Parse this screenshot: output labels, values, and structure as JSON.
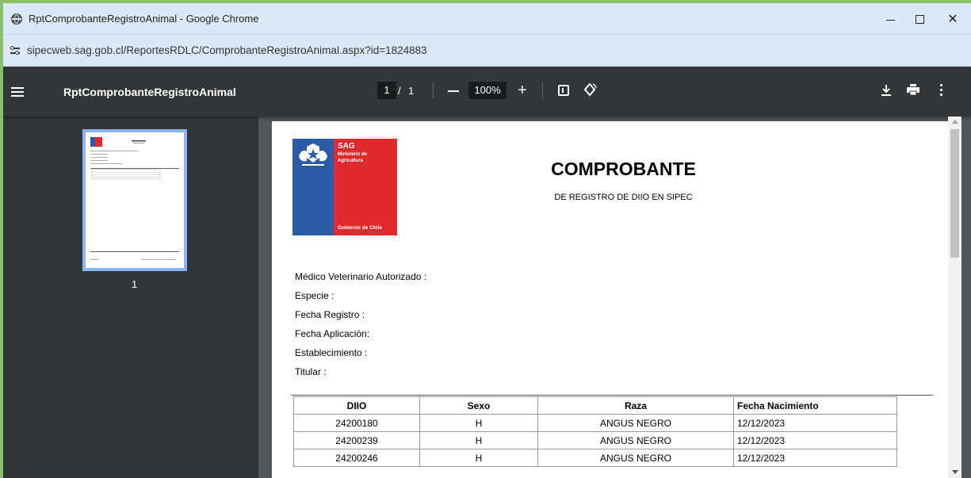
{
  "window": {
    "title": "RptComprobanteRegistroAnimal - Google Chrome",
    "url": "sipecweb.sag.gob.cl/ReportesRDLC/ComprobanteRegistroAnimal.aspx?id=1824883",
    "close_glyph": "✕"
  },
  "pdf_toolbar": {
    "doc_title": "RptComprobanteRegistroAnimal",
    "current_page": "1",
    "page_separator": "/",
    "total_pages": "1",
    "zoom": "100%",
    "zoom_in_glyph": "+"
  },
  "sidebar": {
    "thumbnail_label": "1"
  },
  "document": {
    "logo": {
      "agency": "SAG",
      "ministry": "Ministerio de Agricultura",
      "government": "Gobierno de Chile"
    },
    "heading": "COMPROBANTE",
    "subheading": "DE REGISTRO DE DIIO EN SIPEC",
    "fields": [
      "Médico Veterinario Autorizado :",
      "Especie :",
      "Fecha Registro :",
      "Fecha Aplicación:",
      "Establecimiento :",
      "Titular :"
    ],
    "table": {
      "headers": [
        "DIIO",
        "Sexo",
        "Raza",
        "Fecha Nacimiento"
      ],
      "rows": [
        [
          "24200180",
          "H",
          "ANGUS NEGRO",
          "12/12/2023"
        ],
        [
          "24200239",
          "H",
          "ANGUS NEGRO",
          "12/12/2023"
        ],
        [
          "24200246",
          "H",
          "ANGUS NEGRO",
          "12/12/2023"
        ]
      ]
    }
  },
  "colors": {
    "toolbar": "#323639",
    "viewer_bg": "#525659",
    "thumbnail_border": "#8ab4f8",
    "logo_blue": "#2b5aa6",
    "logo_red": "#e02a2f"
  }
}
